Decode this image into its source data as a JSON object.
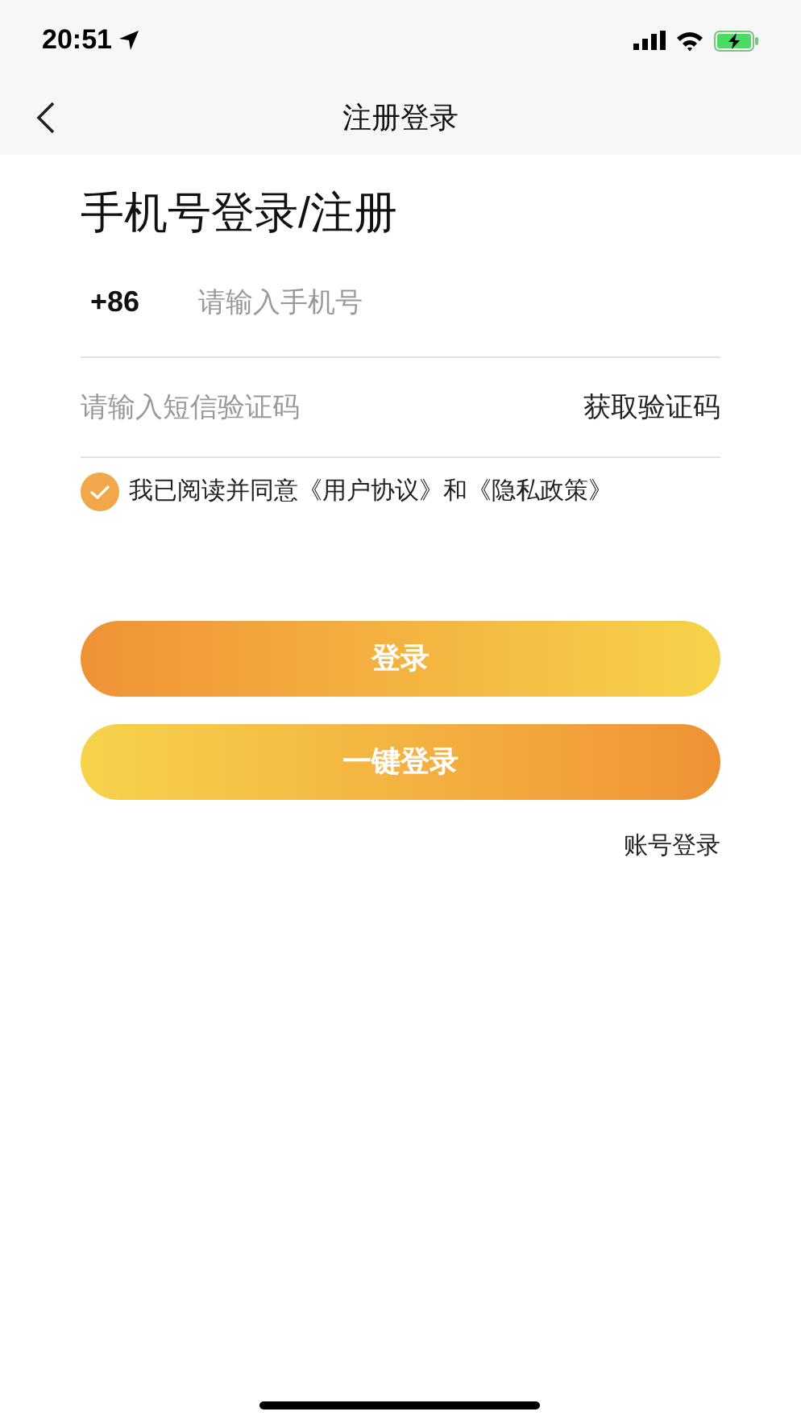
{
  "status_bar": {
    "time": "20:51"
  },
  "nav": {
    "title": "注册登录"
  },
  "heading": "手机号登录/注册",
  "phone": {
    "prefix": "+86",
    "placeholder": "请输入手机号"
  },
  "code": {
    "placeholder": "请输入短信验证码",
    "action": "获取验证码"
  },
  "agreement": {
    "checked": true,
    "text": "我已阅读并同意《用户协议》和《隐私政策》"
  },
  "buttons": [
    {
      "label": "登录",
      "kind": "warm_to_light"
    },
    {
      "label": "一键登录",
      "kind": "light_to_warm"
    }
  ],
  "account_login": "账号登录"
}
